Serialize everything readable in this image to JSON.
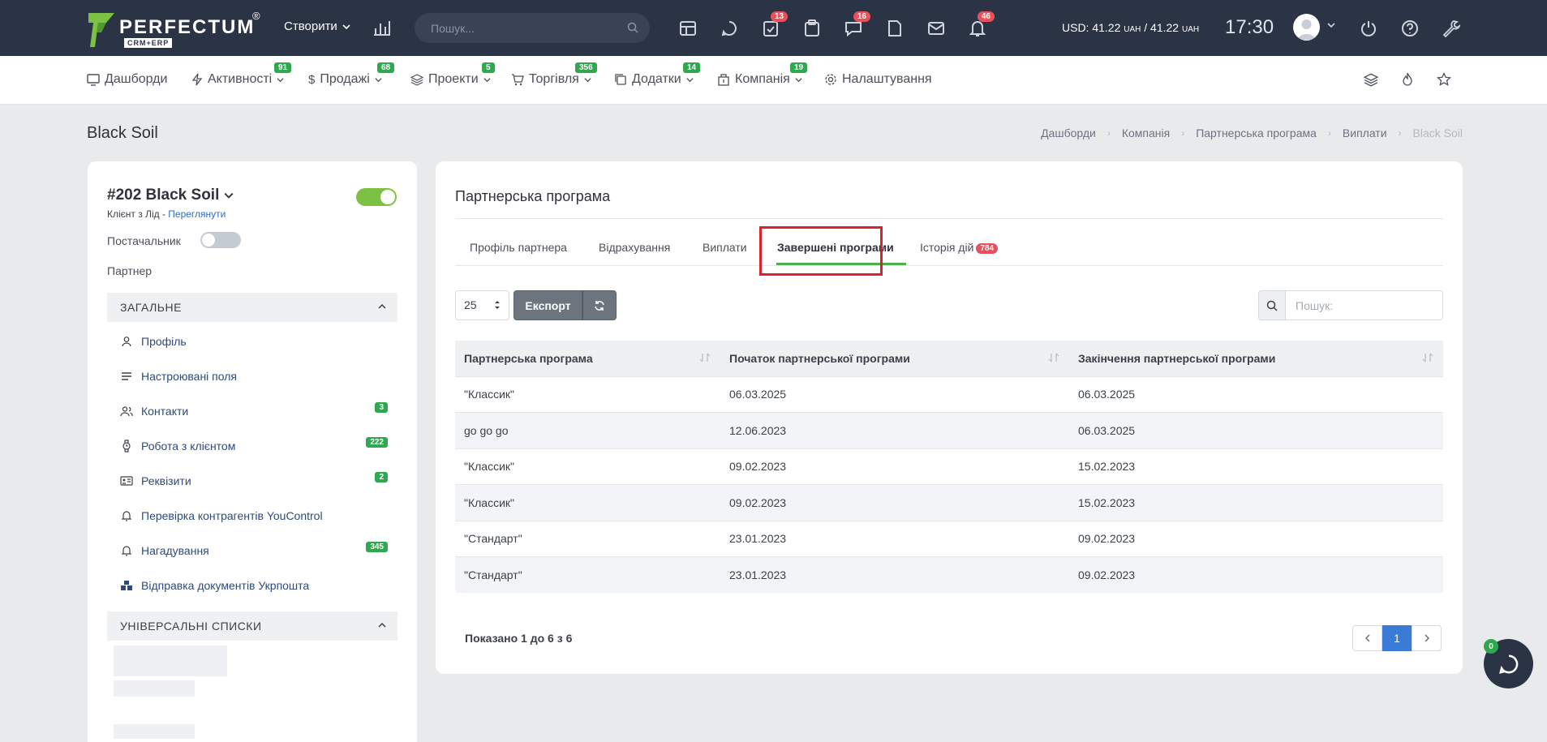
{
  "topbar": {
    "brand": "PERFECTUM",
    "brand_sub": "CRM+ERP",
    "brand_reg": "®",
    "create_label": "Створити",
    "search_placeholder": "Пошук...",
    "icons": [
      {
        "name": "layout-icon",
        "badge": ""
      },
      {
        "name": "chat-bubble-icon",
        "badge": ""
      },
      {
        "name": "task-check-icon",
        "badge": "13"
      },
      {
        "name": "clipboard-icon",
        "badge": ""
      },
      {
        "name": "messages-icon",
        "badge": "16"
      },
      {
        "name": "document-icon",
        "badge": ""
      },
      {
        "name": "mail-icon",
        "badge": ""
      },
      {
        "name": "bell-icon",
        "badge": "46"
      }
    ],
    "currency_prefix": "USD: 41.22",
    "currency_unit": "UAH",
    "currency_sep": " / 41.22 ",
    "clock": "17:30"
  },
  "nav": {
    "items": [
      {
        "label": "Дашборди",
        "badge": "",
        "icon": "monitor-icon"
      },
      {
        "label": "Активності",
        "badge": "91",
        "icon": "bolt-icon"
      },
      {
        "label": "Продажі",
        "badge": "68",
        "icon": "dollar-icon"
      },
      {
        "label": "Проекти",
        "badge": "5",
        "icon": "layers-icon"
      },
      {
        "label": "Торгівля",
        "badge": "356",
        "icon": "cart-icon"
      },
      {
        "label": "Додатки",
        "badge": "14",
        "icon": "copy-icon"
      },
      {
        "label": "Компанія",
        "badge": "19",
        "icon": "building-icon"
      },
      {
        "label": "Налаштування",
        "badge": "",
        "icon": "gear-icon"
      }
    ]
  },
  "page": {
    "title": "Black Soil",
    "breadcrumb": [
      "Дашборди",
      "Компанія",
      "Партнерська програма",
      "Виплати",
      "Black Soil"
    ]
  },
  "left": {
    "client_name": "#202 Black Soil",
    "client_sub": "Клієнт з Лід - ",
    "client_link": "Переглянути",
    "supplier_label": "Постачальник",
    "partner_label": "Партнер",
    "section_general": "ЗАГАЛЬНЕ",
    "section_lists": "УНІВЕРСАЛЬНІ СПИСКИ",
    "items": [
      {
        "label": "Профіль",
        "badge": "",
        "icon": "user-icon"
      },
      {
        "label": "Настроювані поля",
        "badge": "",
        "icon": "lines-icon"
      },
      {
        "label": "Контакти",
        "badge": "3",
        "icon": "users-icon"
      },
      {
        "label": "Робота з клієнтом",
        "badge": "222",
        "icon": "watch-icon"
      },
      {
        "label": "Реквізити",
        "badge": "2",
        "icon": "id-card-icon"
      },
      {
        "label": "Перевірка контрагентів YouControl",
        "badge": "",
        "icon": "bell-icon"
      },
      {
        "label": "Нагадування",
        "badge": "345",
        "icon": "bell-icon"
      },
      {
        "label": "Відправка документів Укрпошта",
        "badge": "",
        "icon": "boxes-icon"
      }
    ]
  },
  "main": {
    "title": "Партнерська програма",
    "tabs": [
      {
        "label": "Профіль партнера"
      },
      {
        "label": "Відрахування"
      },
      {
        "label": "Виплати"
      },
      {
        "label": "Завершені програми"
      },
      {
        "label": "Історія дій",
        "badge": "784"
      }
    ],
    "page_size": "25",
    "export_label": "Експорт",
    "search_placeholder": "Пошук:",
    "columns": [
      "Партнерська програма",
      "Початок партнерської програми",
      "Закінчення партнерської програми"
    ],
    "rows": [
      [
        "\"Классик\"",
        "06.03.2025",
        "06.03.2025"
      ],
      [
        "go go go",
        "12.06.2023",
        "06.03.2025"
      ],
      [
        "\"Классик\"",
        "09.02.2023",
        "15.02.2023"
      ],
      [
        "\"Классик\"",
        "09.02.2023",
        "15.02.2023"
      ],
      [
        "\"Стандарт\"",
        "23.01.2023",
        "09.02.2023"
      ],
      [
        "\"Стандарт\"",
        "23.01.2023",
        "09.02.2023"
      ]
    ],
    "shown_text": "Показано 1 до 6 з 6",
    "current_page": "1"
  },
  "chat": {
    "badge": "0"
  },
  "colors": {
    "topbar": "#2b3445",
    "accent_green": "#2fa84f",
    "badge_red": "#e8505b",
    "highlight": "#d9232d",
    "page_active": "#3a7bd5"
  }
}
